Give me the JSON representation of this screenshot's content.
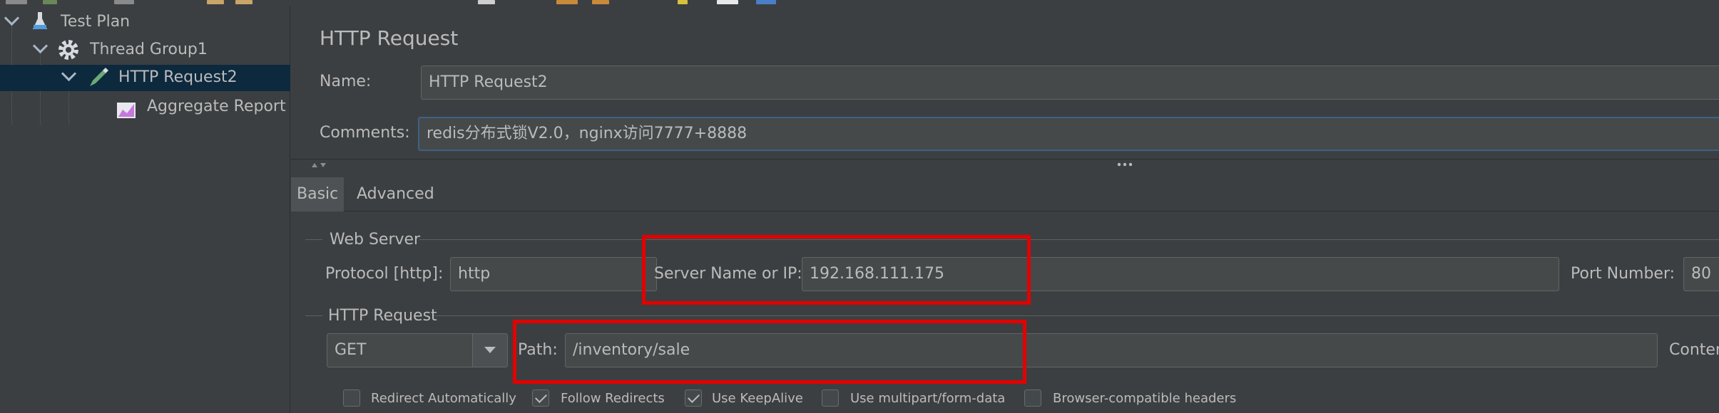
{
  "tree": {
    "items": [
      {
        "label": "Test Plan",
        "icon": "flask-icon"
      },
      {
        "label": "Thread Group1",
        "icon": "gear-icon"
      },
      {
        "label": "HTTP Request2",
        "icon": "pipette-icon"
      },
      {
        "label": "Aggregate Report",
        "icon": "chart-icon"
      }
    ]
  },
  "panel": {
    "title": "HTTP Request",
    "name_label": "Name:",
    "name_value": "HTTP Request2",
    "comments_label": "Comments:",
    "comments_value": "redis分布式锁V2.0，nginx访问7777+8888",
    "tabs": [
      {
        "label": "Basic",
        "active": true
      },
      {
        "label": "Advanced",
        "active": false
      }
    ],
    "web_server": {
      "group_label": "Web Server",
      "protocol_label": "Protocol [http]:",
      "protocol_value": "http",
      "server_label": "Server Name or IP:",
      "server_value": "192.168.111.175",
      "port_label": "Port Number:",
      "port_value": "80"
    },
    "http_request": {
      "group_label": "HTTP Request",
      "method": "GET",
      "path_label": "Path:",
      "path_value": "/inventory/sale",
      "content_label": "Conter"
    },
    "options": [
      {
        "label": "Redirect Automatically",
        "checked": false
      },
      {
        "label": "Follow Redirects",
        "checked": true
      },
      {
        "label": "Use KeepAlive",
        "checked": true
      },
      {
        "label": "Use multipart/form-data",
        "checked": false
      },
      {
        "label": "Browser-compatible headers",
        "checked": false
      }
    ]
  },
  "colors": {
    "background": "#3c3f41",
    "selection": "#0d293e",
    "highlight_box": "#e30000",
    "focus_border": "#3d6185"
  }
}
